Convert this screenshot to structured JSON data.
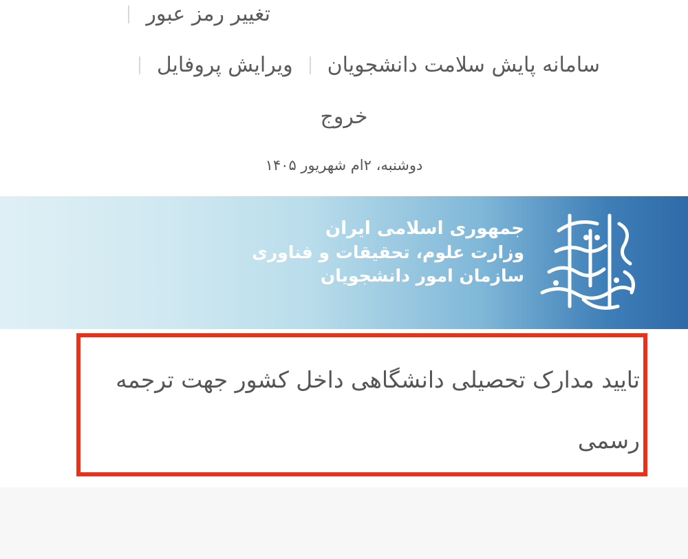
{
  "nav": {
    "change_password": "تغییر رمز عبور",
    "health_monitoring": "سامانه پایش سلامت دانشجویان",
    "edit_profile": "ویرایش پروفایل",
    "logout": "خروج"
  },
  "date_text": "دوشنبه، ۲ام شهریور ۱۴۰۵",
  "banner": {
    "line1": "جمهوری اسلامی ایران",
    "line2": "وزارت علوم، تحقیقات و فناوری",
    "line3": "سازمان امور دانشجویان",
    "emblem_icon": "student-affairs-calligraphy-emblem-icon"
  },
  "content": {
    "title": "تایید مدارک تحصیلی دانشگاهی داخل کشور جهت ترجمه رسمی"
  },
  "colors": {
    "highlight_border": "#e8321a",
    "banner_dark": "#2e6aa8",
    "banner_light": "#dff0f5"
  }
}
